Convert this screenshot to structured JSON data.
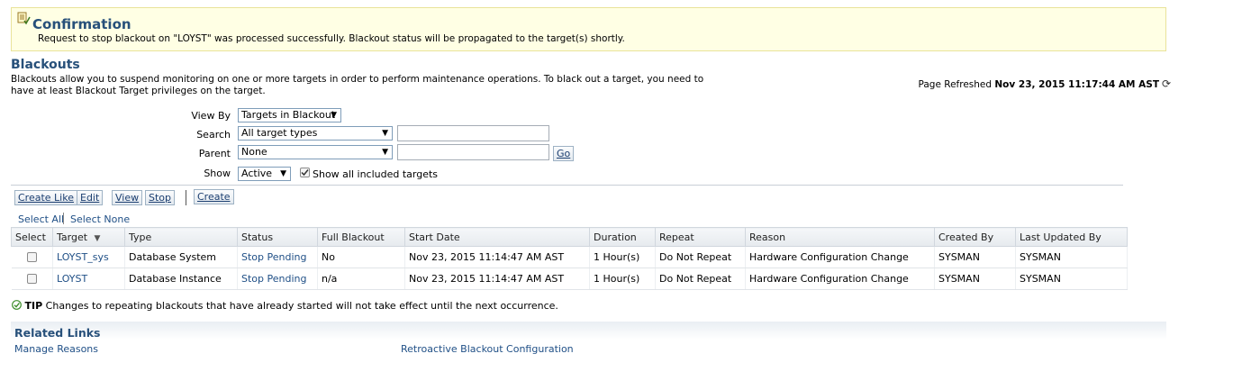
{
  "confirmation": {
    "title": "Confirmation",
    "message": "Request to stop blackout on \"LOYST\" was processed successfully. Blackout status will be propagated to the target(s) shortly."
  },
  "page": {
    "title": "Blackouts",
    "description": "Blackouts allow you to suspend monitoring on one or more targets in order to perform maintenance operations. To black out a target, you need to have at least Blackout Target privileges on the target.",
    "refreshed_label": "Page Refreshed",
    "refreshed_time": "Nov 23, 2015 11:17:44 AM AST"
  },
  "filters": {
    "view_by_label": "View By",
    "view_by_value": "Targets in Blackout",
    "search_label": "Search",
    "search_type_value": "All target types",
    "parent_label": "Parent",
    "parent_value": "None",
    "go_label": "Go",
    "show_label": "Show",
    "show_value": "Active",
    "show_all_label": "Show all included targets"
  },
  "toolbar": {
    "create_like": "Create Like",
    "edit": "Edit",
    "view": "View",
    "stop": "Stop",
    "create": "Create"
  },
  "selection": {
    "select_all": "Select All",
    "select_none": "Select None"
  },
  "table": {
    "headers": [
      "Select",
      "Target",
      "Type",
      "Status",
      "Full Blackout",
      "Start Date",
      "Duration",
      "Repeat",
      "Reason",
      "Created By",
      "Last Updated By"
    ],
    "rows": [
      {
        "target": "LOYST_sys",
        "type": "Database System",
        "status": "Stop Pending",
        "full_blackout": "No",
        "start_date": "Nov 23, 2015 11:14:47 AM AST",
        "duration": "1 Hour(s)",
        "repeat": "Do Not Repeat",
        "reason": "Hardware Configuration Change",
        "created_by": "SYSMAN",
        "last_updated_by": "SYSMAN"
      },
      {
        "target": "LOYST",
        "type": "Database Instance",
        "status": "Stop Pending",
        "full_blackout": "n/a",
        "start_date": "Nov 23, 2015 11:14:47 AM AST",
        "duration": "1 Hour(s)",
        "repeat": "Do Not Repeat",
        "reason": "Hardware Configuration Change",
        "created_by": "SYSMAN",
        "last_updated_by": "SYSMAN"
      }
    ]
  },
  "tip": {
    "label": "TIP",
    "text": "Changes to repeating blackouts that have already started will not take effect until the next occurrence."
  },
  "related": {
    "title": "Related Links",
    "links": [
      "Manage Reasons",
      "Retroactive Blackout Configuration"
    ]
  },
  "colors": {
    "heading": "#27507a",
    "link": "#1f4f86",
    "confirm_bg": "#ffffe4"
  }
}
